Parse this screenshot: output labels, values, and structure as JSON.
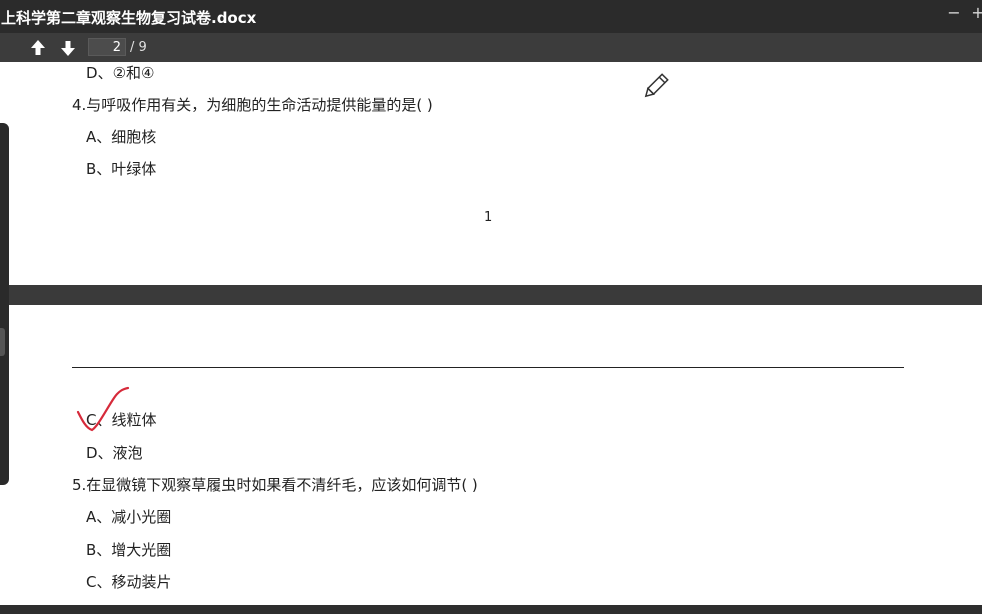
{
  "window": {
    "title": "上科学第二章观察生物复习试卷.docx",
    "minimize_label": "−",
    "maximize_label": "+"
  },
  "toolbar": {
    "current_page": "2",
    "total_pages": "/ 9"
  },
  "page1": {
    "lines": [
      {
        "prefix": "D、",
        "c1": "②",
        "mid": "和",
        "c2": "④"
      },
      "4.与呼吸作用有关，为细胞的生命活动提供能量的是(     )",
      "A、细胞核",
      "B、叶绿体"
    ],
    "page_number": "1"
  },
  "page2": {
    "lines": [
      "C、线粒体",
      "D、液泡",
      "5.在显微镜下观察草履虫时如果看不清纤毛，应该如何调节(     )",
      "A、减小光圈",
      "B、增大光圈",
      "C、移动装片"
    ]
  },
  "annotations": {
    "check_color": "#d62a3a",
    "pencil_icon": "pencil-icon"
  }
}
